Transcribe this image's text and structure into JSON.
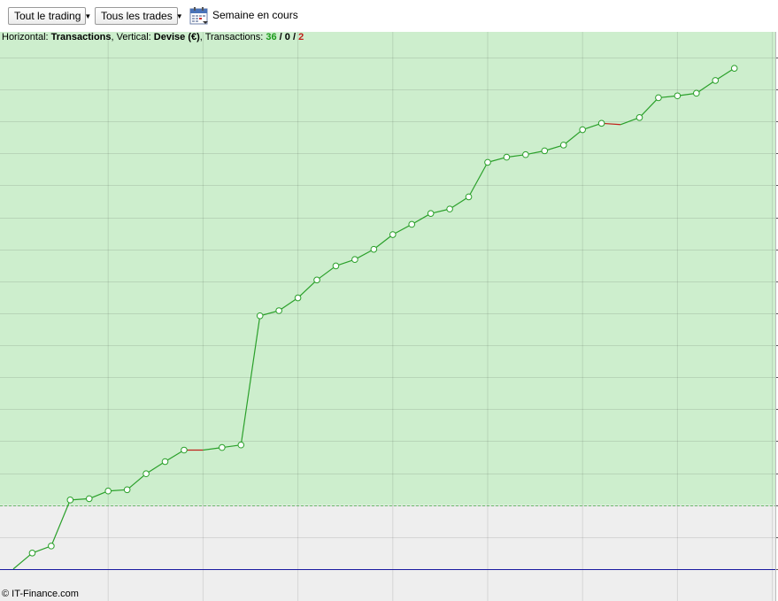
{
  "toolbar": {
    "trading_select": "Tout le trading",
    "trades_select": "Tous les trades",
    "calendar_icon": "calendar-icon",
    "period_label": "Semaine en cours"
  },
  "info": {
    "horizontal_prefix": "Horizontal: ",
    "horizontal_value": "Transactions",
    "vertical_prefix": ", Vertical: ",
    "vertical_value": "Devise (€)",
    "transactions_prefix": ", Transactions: ",
    "wins": "36",
    "sep1": " / ",
    "neutral": "0",
    "sep2": " / ",
    "losses": "2"
  },
  "copyright": "© IT-Finance.com",
  "colors": {
    "positive_fill": "#cdeecd",
    "negative_fill": "#eeeeee",
    "line_up": "#2aa02a",
    "line_down": "#c0201a",
    "zero_line": "#1a1aa0"
  },
  "chart_data": {
    "type": "line",
    "title": "",
    "xlabel": "Transactions",
    "ylabel": "Devise (€)",
    "grid": true,
    "x": [
      0,
      1,
      2,
      3,
      4,
      5,
      6,
      7,
      8,
      9,
      10,
      11,
      12,
      13,
      14,
      15,
      16,
      17,
      18,
      19,
      20,
      21,
      22,
      23,
      24,
      25,
      26,
      27,
      28,
      29,
      30,
      31,
      32,
      33,
      34,
      35,
      36,
      37,
      38
    ],
    "values": [
      0,
      2.5,
      3.6,
      10.8,
      11.0,
      12.2,
      12.4,
      14.9,
      16.8,
      18.6,
      18.6,
      19.0,
      19.4,
      39.6,
      40.4,
      42.4,
      45.2,
      47.4,
      48.4,
      50.0,
      52.3,
      53.9,
      55.6,
      56.3,
      58.2,
      63.6,
      64.4,
      64.8,
      65.4,
      66.3,
      68.7,
      69.7,
      69.5,
      70.6,
      73.7,
      74.0,
      74.4,
      76.4,
      78.3
    ],
    "loss_segments": [
      [
        9,
        10
      ],
      [
        31,
        32
      ]
    ],
    "xlim": [
      -0.7,
      40.3
    ],
    "ylim": [
      -5.0,
      84.0
    ],
    "baseline": 10.0
  }
}
